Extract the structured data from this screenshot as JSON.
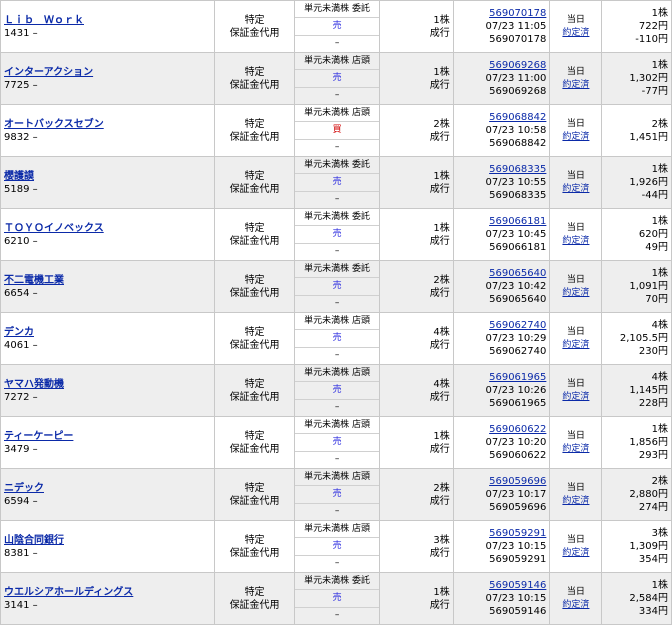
{
  "orders": [
    {
      "name": "Ｌｉｂ　Ｗｏｒｋ",
      "code": "1431 –",
      "account": "特定",
      "margin": "保証金代用",
      "type": "単元未満株 委託",
      "side": "売",
      "side_kind": "sell",
      "dash": "–",
      "qty": "1株",
      "exec": "成行",
      "order_no": "569070178",
      "time": "07/23 11:05",
      "order_no2": "569070178",
      "term": "当日",
      "term_link": "約定済",
      "exec_qty": "1株",
      "exec_price": "722円",
      "pnl": "-110円"
    },
    {
      "name": "インターアクション",
      "code": "7725 –",
      "account": "特定",
      "margin": "保証金代用",
      "type": "単元未満株 店頭",
      "side": "売",
      "side_kind": "sell",
      "dash": "–",
      "qty": "1株",
      "exec": "成行",
      "order_no": "569069268",
      "time": "07/23 11:00",
      "order_no2": "569069268",
      "term": "当日",
      "term_link": "約定済",
      "exec_qty": "1株",
      "exec_price": "1,302円",
      "pnl": "-77円"
    },
    {
      "name": "オートバックスセブン",
      "code": "9832 –",
      "account": "特定",
      "margin": "保証金代用",
      "type": "単元未満株 店頭",
      "side": "買",
      "side_kind": "buy",
      "dash": "–",
      "qty": "2株",
      "exec": "成行",
      "order_no": "569068842",
      "time": "07/23 10:58",
      "order_no2": "569068842",
      "term": "当日",
      "term_link": "約定済",
      "exec_qty": "2株",
      "exec_price": "1,451円",
      "pnl": ""
    },
    {
      "name": "櫻護謨",
      "code": "5189 –",
      "account": "特定",
      "margin": "保証金代用",
      "type": "単元未満株 委託",
      "side": "売",
      "side_kind": "sell",
      "dash": "–",
      "qty": "1株",
      "exec": "成行",
      "order_no": "569068335",
      "time": "07/23 10:55",
      "order_no2": "569068335",
      "term": "当日",
      "term_link": "約定済",
      "exec_qty": "1株",
      "exec_price": "1,926円",
      "pnl": "-44円"
    },
    {
      "name": "ＴＯＹＯイノベックス",
      "code": "6210 –",
      "account": "特定",
      "margin": "保証金代用",
      "type": "単元未満株 委託",
      "side": "売",
      "side_kind": "sell",
      "dash": "–",
      "qty": "1株",
      "exec": "成行",
      "order_no": "569066181",
      "time": "07/23 10:45",
      "order_no2": "569066181",
      "term": "当日",
      "term_link": "約定済",
      "exec_qty": "1株",
      "exec_price": "620円",
      "pnl": "49円"
    },
    {
      "name": "不二電機工業",
      "code": "6654 –",
      "account": "特定",
      "margin": "保証金代用",
      "type": "単元未満株 委託",
      "side": "売",
      "side_kind": "sell",
      "dash": "–",
      "qty": "2株",
      "exec": "成行",
      "order_no": "569065640",
      "time": "07/23 10:42",
      "order_no2": "569065640",
      "term": "当日",
      "term_link": "約定済",
      "exec_qty": "1株",
      "exec_price": "1,091円",
      "pnl": "70円"
    },
    {
      "name": "デンカ",
      "code": "4061 –",
      "account": "特定",
      "margin": "保証金代用",
      "type": "単元未満株 店頭",
      "side": "売",
      "side_kind": "sell",
      "dash": "–",
      "qty": "4株",
      "exec": "成行",
      "order_no": "569062740",
      "time": "07/23 10:29",
      "order_no2": "569062740",
      "term": "当日",
      "term_link": "約定済",
      "exec_qty": "4株",
      "exec_price": "2,105.5円",
      "pnl": "230円"
    },
    {
      "name": "ヤマハ発動機",
      "code": "7272 –",
      "account": "特定",
      "margin": "保証金代用",
      "type": "単元未満株 店頭",
      "side": "売",
      "side_kind": "sell",
      "dash": "–",
      "qty": "4株",
      "exec": "成行",
      "order_no": "569061965",
      "time": "07/23 10:26",
      "order_no2": "569061965",
      "term": "当日",
      "term_link": "約定済",
      "exec_qty": "4株",
      "exec_price": "1,145円",
      "pnl": "228円"
    },
    {
      "name": "ティーケーピー",
      "code": "3479 –",
      "account": "特定",
      "margin": "保証金代用",
      "type": "単元未満株 店頭",
      "side": "売",
      "side_kind": "sell",
      "dash": "–",
      "qty": "1株",
      "exec": "成行",
      "order_no": "569060622",
      "time": "07/23 10:20",
      "order_no2": "569060622",
      "term": "当日",
      "term_link": "約定済",
      "exec_qty": "1株",
      "exec_price": "1,856円",
      "pnl": "293円"
    },
    {
      "name": "ニデック",
      "code": "6594 –",
      "account": "特定",
      "margin": "保証金代用",
      "type": "単元未満株 店頭",
      "side": "売",
      "side_kind": "sell",
      "dash": "–",
      "qty": "2株",
      "exec": "成行",
      "order_no": "569059696",
      "time": "07/23 10:17",
      "order_no2": "569059696",
      "term": "当日",
      "term_link": "約定済",
      "exec_qty": "2株",
      "exec_price": "2,880円",
      "pnl": "274円"
    },
    {
      "name": "山陰合同銀行",
      "code": "8381 –",
      "account": "特定",
      "margin": "保証金代用",
      "type": "単元未満株 店頭",
      "side": "売",
      "side_kind": "sell",
      "dash": "–",
      "qty": "3株",
      "exec": "成行",
      "order_no": "569059291",
      "time": "07/23 10:15",
      "order_no2": "569059291",
      "term": "当日",
      "term_link": "約定済",
      "exec_qty": "3株",
      "exec_price": "1,309円",
      "pnl": "354円"
    },
    {
      "name": "ウエルシアホールディングス",
      "code": "3141 –",
      "account": "特定",
      "margin": "保証金代用",
      "type": "単元未満株 委託",
      "side": "売",
      "side_kind": "sell",
      "dash": "–",
      "qty": "1株",
      "exec": "成行",
      "order_no": "569059146",
      "time": "07/23 10:15",
      "order_no2": "569059146",
      "term": "当日",
      "term_link": "約定済",
      "exec_qty": "1株",
      "exec_price": "2,584円",
      "pnl": "334円"
    }
  ]
}
